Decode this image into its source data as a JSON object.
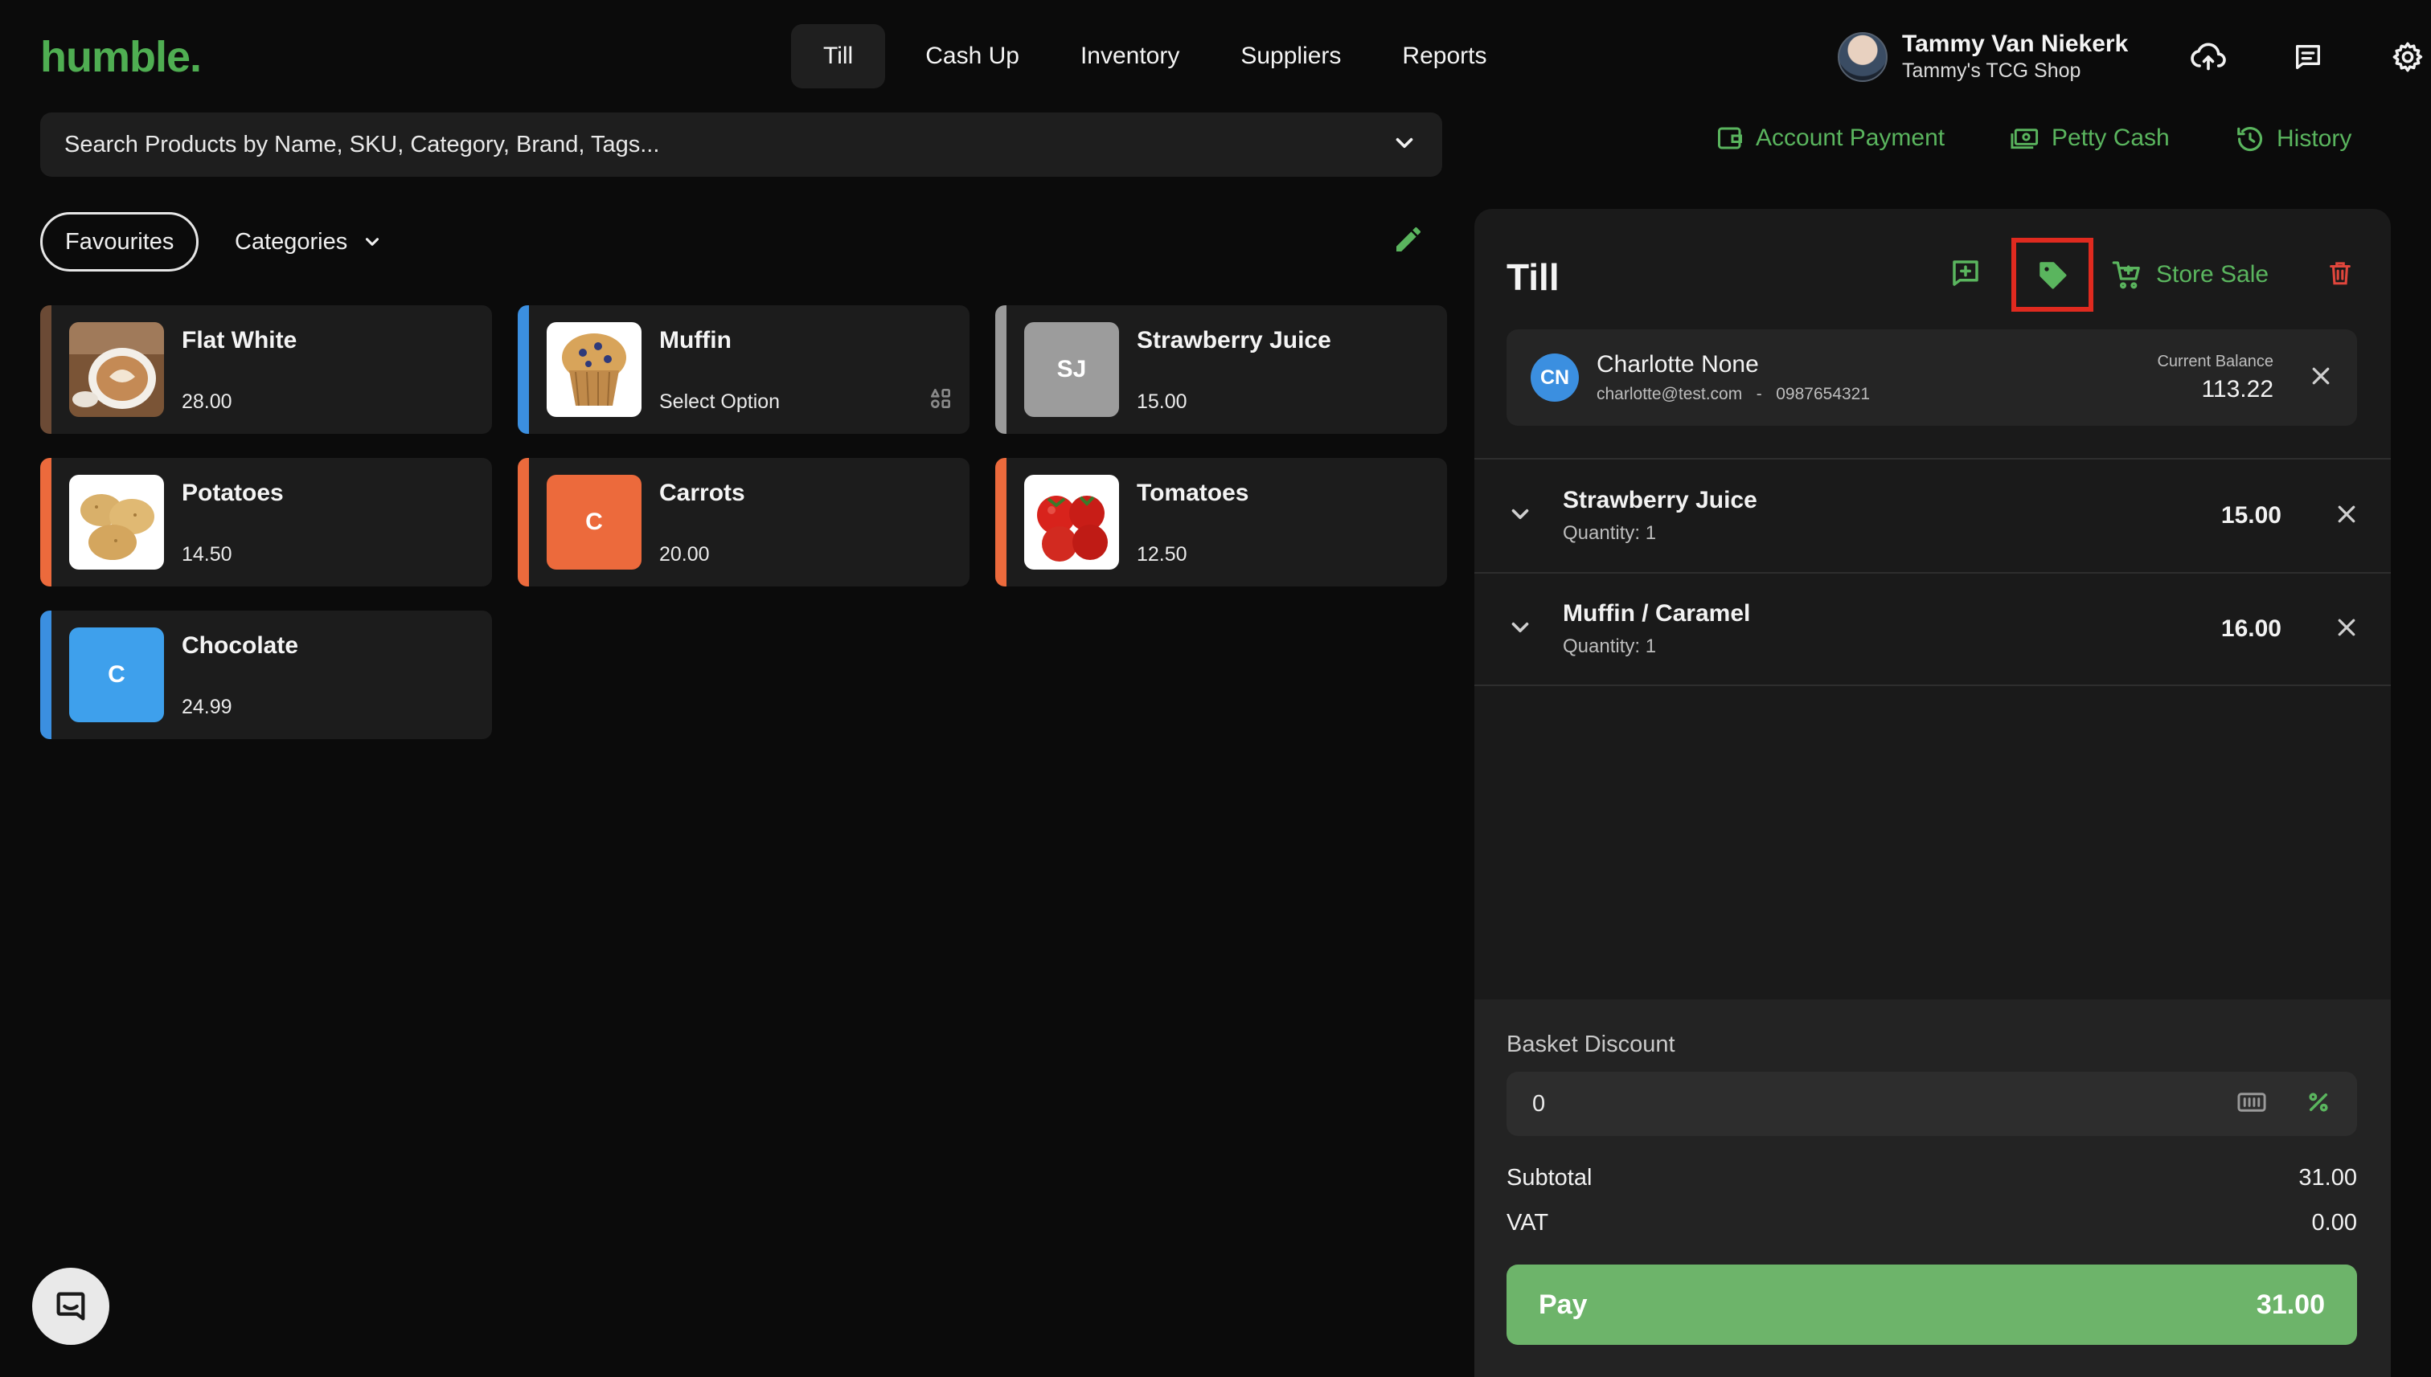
{
  "app": {
    "logo": "humble."
  },
  "nav": {
    "items": [
      "Till",
      "Cash Up",
      "Inventory",
      "Suppliers",
      "Reports"
    ],
    "active": "Till"
  },
  "user": {
    "name": "Tammy Van Niekerk",
    "shop": "Tammy's TCG Shop"
  },
  "search": {
    "placeholder": "Search Products by Name, SKU, Category, Brand, Tags..."
  },
  "actions": {
    "account_payment": "Account Payment",
    "petty_cash": "Petty Cash",
    "history": "History"
  },
  "filters": {
    "favourites": "Favourites",
    "categories": "Categories"
  },
  "products": [
    {
      "name": "Flat White",
      "price": "28.00",
      "stripe": "#6b4a35",
      "thumb_type": "image",
      "thumb_icon": "coffee-image",
      "thumb_text": ""
    },
    {
      "name": "Muffin",
      "price": "Select Option",
      "stripe": "#3b8fe0",
      "thumb_type": "image",
      "thumb_icon": "muffin-image",
      "thumb_text": "",
      "has_variants": true
    },
    {
      "name": "Strawberry Juice",
      "price": "15.00",
      "stripe": "#9a9a9a",
      "thumb_type": "initials",
      "thumb_icon": "",
      "thumb_text": "SJ",
      "thumb_color": "#9c9c9c"
    },
    {
      "name": "Potatoes",
      "price": "14.50",
      "stripe": "#ec6a3c",
      "thumb_type": "image",
      "thumb_icon": "potatoes-image",
      "thumb_text": ""
    },
    {
      "name": "Carrots",
      "price": "20.00",
      "stripe": "#ec6a3c",
      "thumb_type": "initials",
      "thumb_icon": "",
      "thumb_text": "C",
      "thumb_color": "#ec6a3c"
    },
    {
      "name": "Tomatoes",
      "price": "12.50",
      "stripe": "#ec6a3c",
      "thumb_type": "image",
      "thumb_icon": "tomatoes-image",
      "thumb_text": ""
    },
    {
      "name": "Chocolate",
      "price": "24.99",
      "stripe": "#3b8fe0",
      "thumb_type": "initials",
      "thumb_icon": "",
      "thumb_text": "C",
      "thumb_color": "#3ea0ec"
    }
  ],
  "till": {
    "title": "Till",
    "store_sale": "Store Sale",
    "customer": {
      "initials": "CN",
      "name": "Charlotte None",
      "email": "charlotte@test.com",
      "separator": "-",
      "phone": "0987654321",
      "balance_label": "Current Balance",
      "balance": "113.22"
    },
    "items": [
      {
        "name": "Strawberry Juice",
        "qty_label": "Quantity: 1",
        "price": "15.00"
      },
      {
        "name": "Muffin / Caramel",
        "qty_label": "Quantity: 1",
        "price": "16.00"
      }
    ],
    "discount": {
      "label": "Basket Discount",
      "value": "0"
    },
    "subtotal": {
      "label": "Subtotal",
      "value": "31.00"
    },
    "vat": {
      "label": "VAT",
      "value": "0.00"
    },
    "pay": {
      "label": "Pay",
      "amount": "31.00"
    }
  },
  "colors": {
    "accent_green": "#5ab55e",
    "pay_green": "#6db46a",
    "highlight_red": "#e02a1f",
    "delete_red": "#e0463c"
  }
}
